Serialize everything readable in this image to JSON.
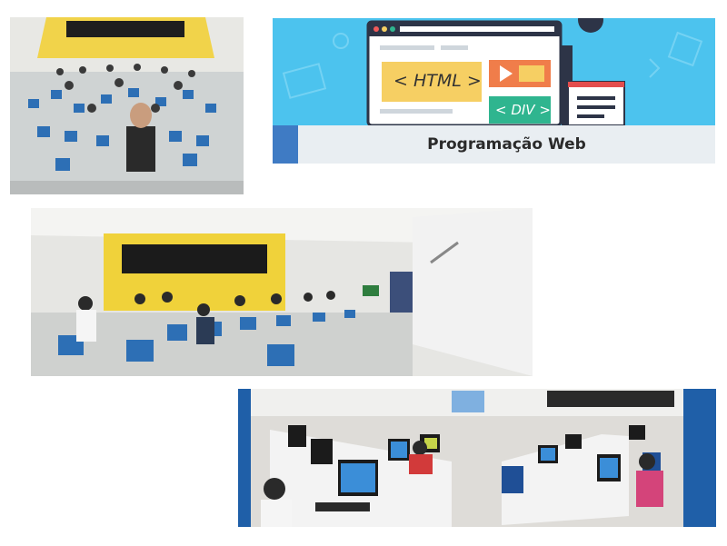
{
  "banner": {
    "title": "Programação Web",
    "html_tag": "< HTML >",
    "div_tag": "< DIV >",
    "colors": {
      "background": "#4cc3ee",
      "bar": "#e9eef2",
      "accent": "#3f7bc4",
      "html_box": "#f6cf63",
      "play_box": "#f07d4a",
      "div_box": "#2fb58f"
    }
  },
  "photos": [
    {
      "name": "classroom-selfie-photo",
      "description_color": "#f1d34a"
    },
    {
      "name": "classroom-panorama-photo",
      "description_color": "#f0d23a"
    },
    {
      "name": "computer-lab-panorama-photo",
      "description_color": "#1f5fa8"
    }
  ]
}
